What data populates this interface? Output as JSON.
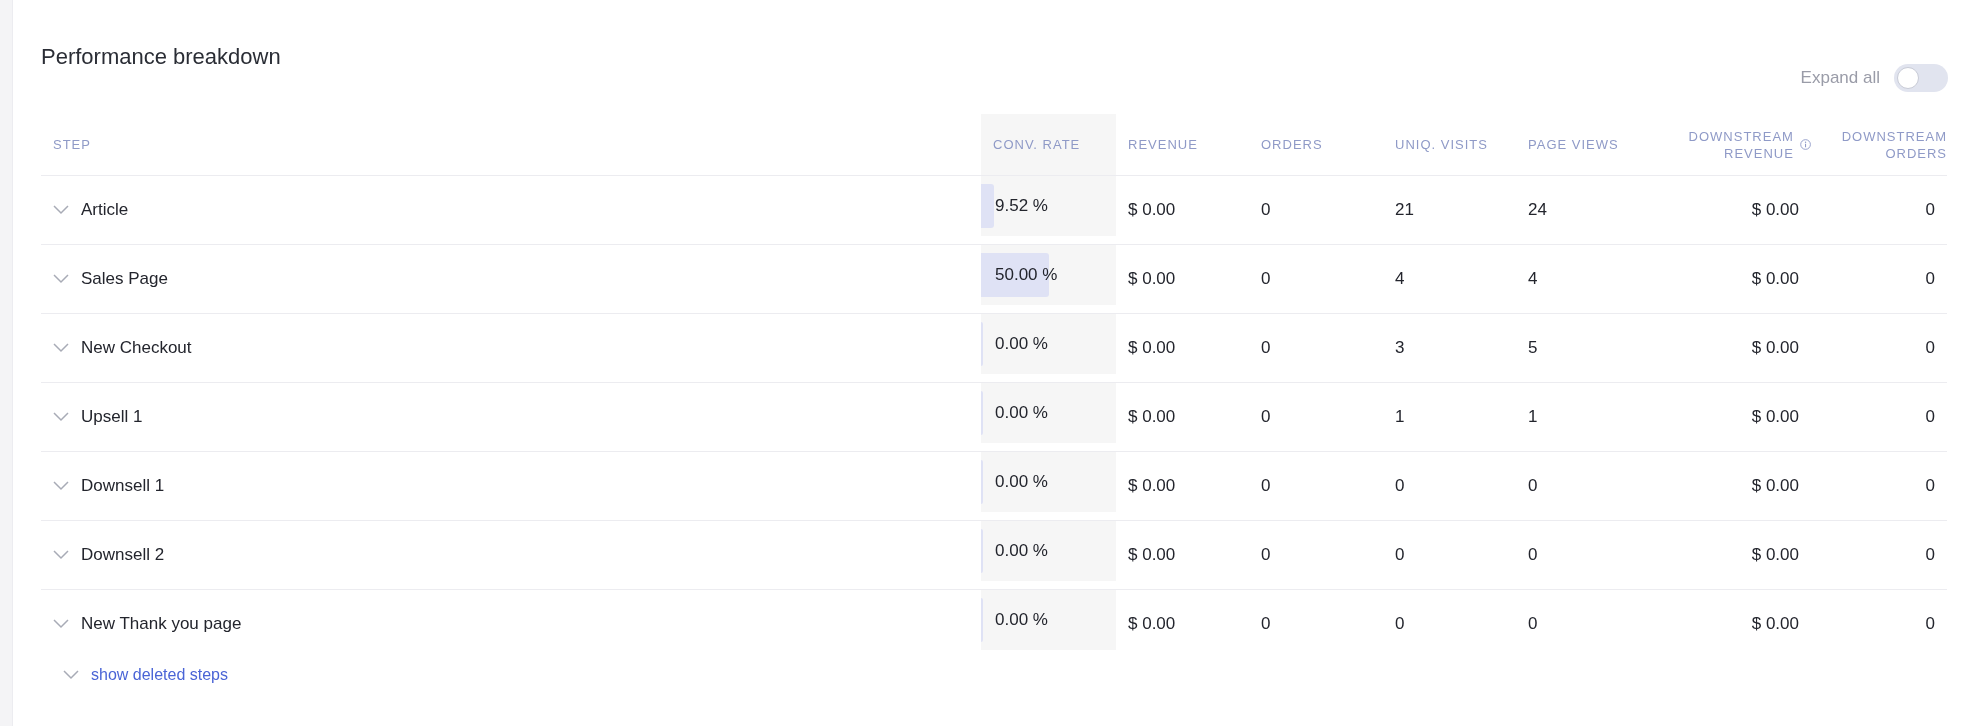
{
  "title": "Performance breakdown",
  "expand_all": {
    "label": "Expand all",
    "on": false
  },
  "table": {
    "columns": [
      {
        "label": "STEP"
      },
      {
        "label": "CONV. RATE"
      },
      {
        "label": "REVENUE"
      },
      {
        "label": "ORDERS"
      },
      {
        "label": "UNIQ. VISITS"
      },
      {
        "label": "PAGE VIEWS"
      },
      {
        "label": "DOWNSTREAM REVENUE",
        "info": true
      },
      {
        "label": "DOWNSTREAM ORDERS"
      }
    ],
    "rows": [
      {
        "level": 0.0952,
        "cells": [
          "Article",
          "9.52 %",
          "$ 0.00",
          "0",
          "21",
          "24",
          "$ 0.00",
          "0"
        ]
      },
      {
        "level": 0.5,
        "cells": [
          "Sales Page",
          "50.00 %",
          "$ 0.00",
          "0",
          "4",
          "4",
          "$ 0.00",
          "0"
        ]
      },
      {
        "level": 0,
        "cells": [
          "New Checkout",
          "0.00 %",
          "$ 0.00",
          "0",
          "3",
          "5",
          "$ 0.00",
          "0"
        ]
      },
      {
        "level": 0,
        "cells": [
          "Upsell 1",
          "0.00 %",
          "$ 0.00",
          "0",
          "1",
          "1",
          "$ 0.00",
          "0"
        ]
      },
      {
        "level": 0,
        "cells": [
          "Downsell 1",
          "0.00 %",
          "$ 0.00",
          "0",
          "0",
          "0",
          "$ 0.00",
          "0"
        ]
      },
      {
        "level": 0,
        "cells": [
          "Downsell 2",
          "0.00 %",
          "$ 0.00",
          "0",
          "0",
          "0",
          "$ 0.00",
          "0"
        ]
      },
      {
        "level": 0,
        "cells": [
          "New Thank you page",
          "0.00 %",
          "$ 0.00",
          "0",
          "0",
          "0",
          "$ 0.00",
          "0"
        ]
      }
    ]
  },
  "show_deleted": "show deleted steps"
}
